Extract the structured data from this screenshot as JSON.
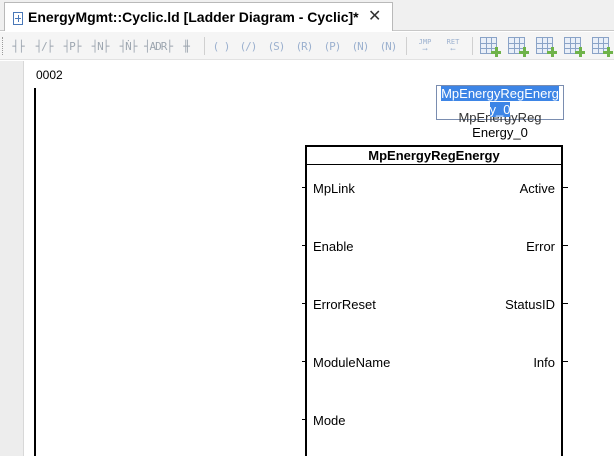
{
  "tab": {
    "title": "EnergyMgmt::Cyclic.ld [Ladder Diagram - Cyclic]*",
    "close_glyph": "✕"
  },
  "toolbar": {
    "contact_buttons": [
      {
        "name": "open-contact",
        "glyph": "┤├"
      },
      {
        "name": "closed-contact",
        "glyph": "┤/├"
      },
      {
        "name": "positive-edge-contact",
        "glyph": "┤P├"
      },
      {
        "name": "negative-edge-contact",
        "glyph": "┤N├"
      },
      {
        "name": "negative-edge-contact-2",
        "glyph": "┤Ṅ├"
      },
      {
        "name": "address-contact",
        "glyph": "┤ADR├"
      },
      {
        "name": "parallel-branch",
        "glyph": "╫"
      }
    ],
    "coil_buttons": [
      {
        "name": "coil",
        "glyph": "( )"
      },
      {
        "name": "negated-coil",
        "glyph": "(/)"
      },
      {
        "name": "set-coil",
        "glyph": "(S)"
      },
      {
        "name": "reset-coil",
        "glyph": "(R)"
      },
      {
        "name": "positive-transition-coil",
        "glyph": "(P)"
      },
      {
        "name": "negative-transition-coil",
        "glyph": "(N)"
      },
      {
        "name": "negated-transition-coil",
        "glyph": "(N)"
      }
    ],
    "jump_label": "JMP",
    "return_label": "RET",
    "accent_color": "#6fb34a"
  },
  "editor": {
    "rung_number": "0002",
    "instance_name_editing": "MpEnergyRegEnergy_0",
    "instance_name_editing_line1": "MpEnergyRegEnerg",
    "instance_name_editing_line2": "y_0",
    "instance_name_ghost": "MpEnergyReg",
    "instance_name_line1": "MpEnergyReg",
    "instance_name_line2": "Energy_0",
    "selection_color": "#3d85e6",
    "function_block": {
      "type": "MpEnergyRegEnergy",
      "inputs": [
        "MpLink",
        "Enable",
        "ErrorReset",
        "ModuleName",
        "Mode"
      ],
      "outputs": [
        "Active",
        "Error",
        "StatusID",
        "Info"
      ]
    }
  }
}
